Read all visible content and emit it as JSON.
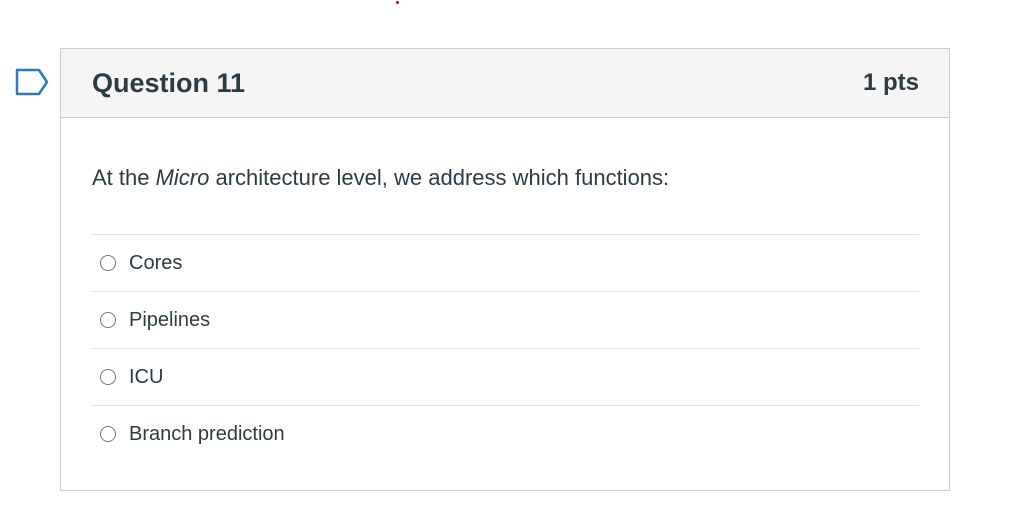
{
  "question": {
    "title": "Question 11",
    "points": "1 pts",
    "text_before": "At the ",
    "text_emphasis": "Micro",
    "text_after": " architecture level, we address which functions:",
    "answers": [
      {
        "label": "Cores",
        "selected": false
      },
      {
        "label": "Pipelines",
        "selected": false
      },
      {
        "label": "ICU",
        "selected": false
      },
      {
        "label": "Branch prediction",
        "selected": false
      }
    ]
  },
  "colors": {
    "flag": "#2b7abc",
    "header_bg": "#f5f5f5",
    "text": "#2d3b45",
    "border": "#c7cdd1"
  },
  "icons": {
    "flag": "flag-question-icon"
  }
}
